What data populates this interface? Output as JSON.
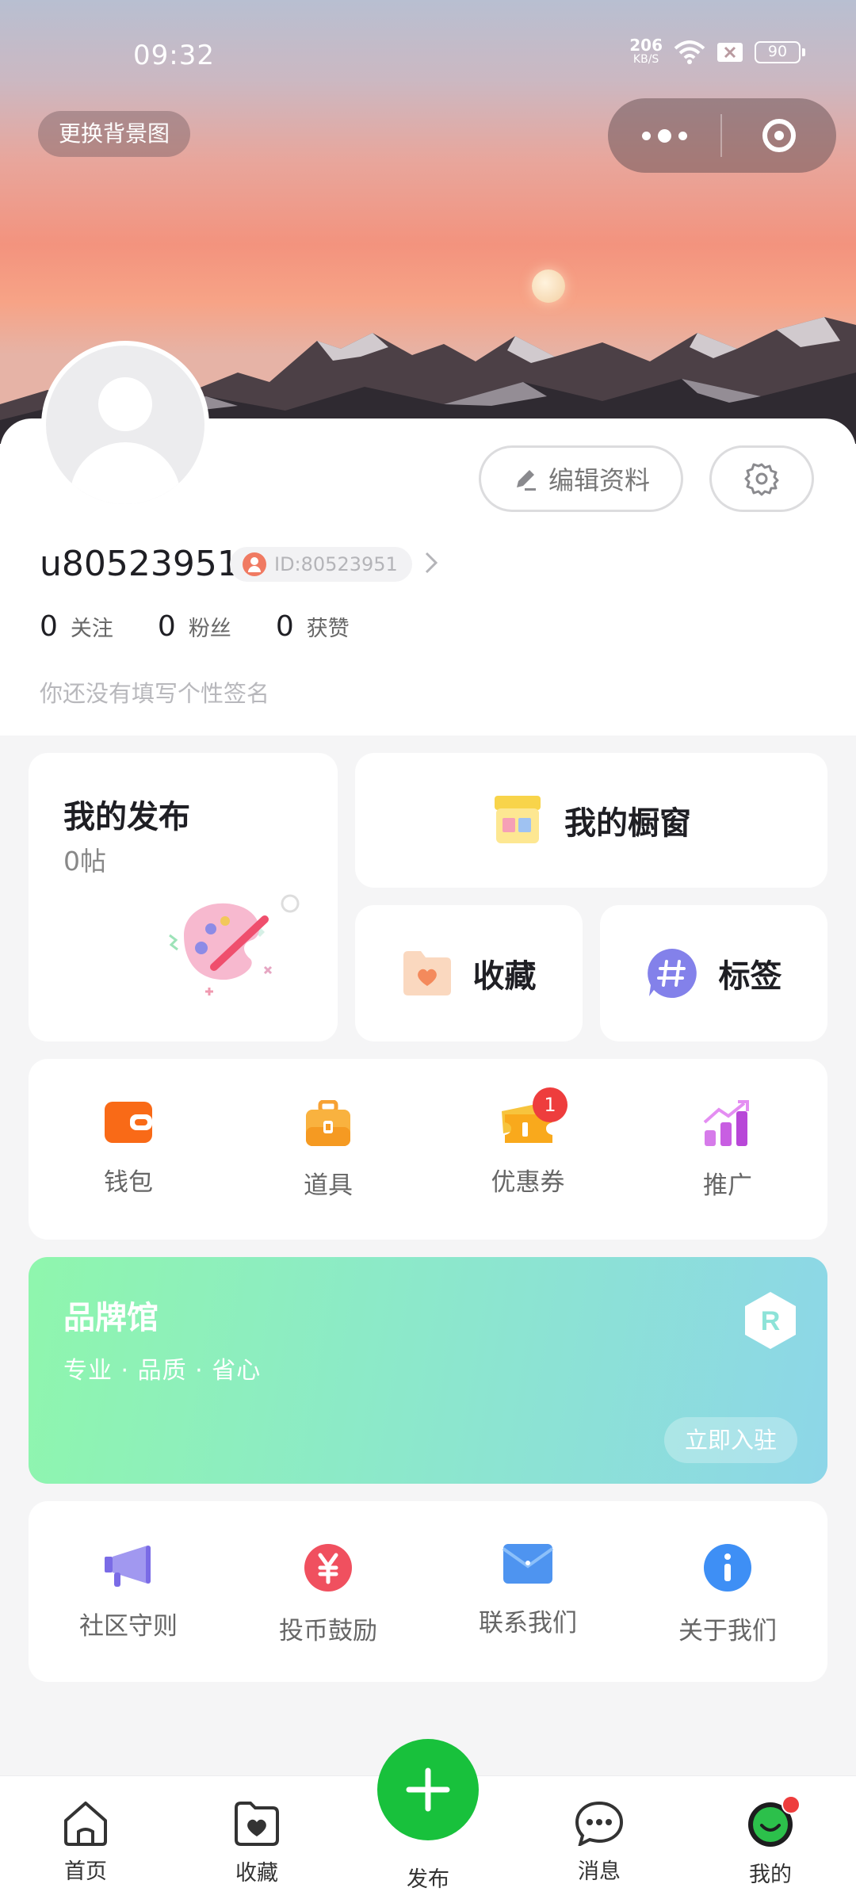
{
  "status_bar": {
    "time": "09:32",
    "net_speed_value": "206",
    "net_speed_unit": "KB/S",
    "battery": "90"
  },
  "header": {
    "change_background_label": "更换背景图"
  },
  "profile": {
    "username": "u80523951",
    "id_label": "ID:80523951",
    "edit_label": "编辑资料",
    "stats": [
      {
        "value": "0",
        "label": "关注"
      },
      {
        "value": "0",
        "label": "粉丝"
      },
      {
        "value": "0",
        "label": "获赞"
      }
    ],
    "signature": "你还没有填写个性签名"
  },
  "cards": {
    "my_posts": {
      "title": "我的发布",
      "count": "0帖"
    },
    "shop": {
      "label": "我的橱窗"
    },
    "favorites": {
      "label": "收藏"
    },
    "tags": {
      "label": "标签"
    }
  },
  "tools": [
    {
      "label": "钱包",
      "icon": "wallet-icon"
    },
    {
      "label": "道具",
      "icon": "props-icon"
    },
    {
      "label": "优惠券",
      "icon": "coupon-icon",
      "badge": "1"
    },
    {
      "label": "推广",
      "icon": "promotion-icon"
    }
  ],
  "brand": {
    "title": "品牌馆",
    "subtitle": "专业 · 品质 · 省心",
    "join_label": "立即入驻",
    "logo_letter": "R"
  },
  "about": [
    {
      "label": "社区守则",
      "icon": "megaphone-icon"
    },
    {
      "label": "投币鼓励",
      "icon": "yuan-coin-icon"
    },
    {
      "label": "联系我们",
      "icon": "envelope-icon"
    },
    {
      "label": "关于我们",
      "icon": "info-icon"
    }
  ],
  "tabbar": [
    {
      "label": "首页",
      "icon": "home-icon"
    },
    {
      "label": "收藏",
      "icon": "favorites-tab-icon"
    },
    {
      "label": "发布",
      "icon": "plus-icon"
    },
    {
      "label": "消息",
      "icon": "message-icon"
    },
    {
      "label": "我的",
      "icon": "profile-tab-icon"
    }
  ],
  "colors": {
    "accent_green": "#18c13c",
    "badge_red": "#ee3d3d",
    "brand_gradient_start": "#8ff6ad",
    "brand_gradient_end": "#8dd6e8"
  }
}
